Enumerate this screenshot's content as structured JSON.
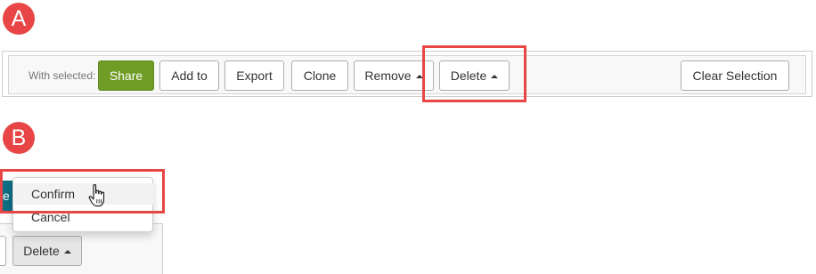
{
  "panel_a": {
    "badge": "A",
    "with_selected_label": "With selected:",
    "buttons": {
      "share": "Share",
      "add_to": "Add to",
      "export": "Export",
      "clone": "Clone",
      "remove": "Remove",
      "delete": "Delete",
      "clear_selection": "Clear Selection"
    }
  },
  "panel_b": {
    "badge": "B",
    "partial_button_text": "e",
    "menu_items": {
      "confirm": "Confirm",
      "cancel": "Cancel"
    },
    "delete_button": "Delete"
  },
  "colors": {
    "badge_red": "#e84646",
    "highlight_red": "#e84646",
    "share_green": "#6f9c25",
    "teal_fragment": "#0e6f84"
  },
  "icons": {
    "caret": "caret-up-icon",
    "cursor": "hand-pointer-icon"
  }
}
